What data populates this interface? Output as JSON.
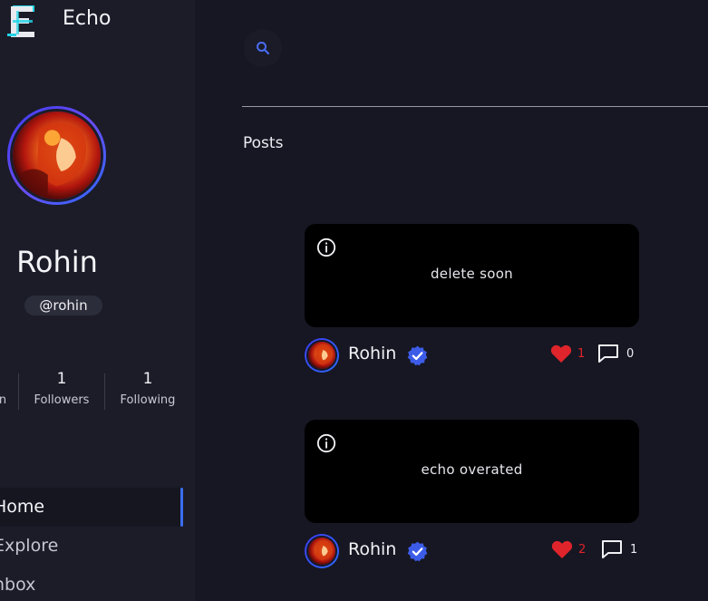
{
  "app": {
    "title": "Echo",
    "logo_letter": "E"
  },
  "profile": {
    "name": "Rohin",
    "handle": "@rohin",
    "stats": [
      {
        "value": "",
        "label": "n"
      },
      {
        "value": "1",
        "label": "Followers"
      },
      {
        "value": "1",
        "label": "Following"
      }
    ]
  },
  "nav": {
    "items": [
      {
        "label": "Home",
        "active": true
      },
      {
        "label": "Explore",
        "active": false
      },
      {
        "label": "nbox",
        "active": false
      }
    ]
  },
  "main": {
    "section_title": "Posts",
    "posts": [
      {
        "text": "delete soon",
        "author": "Rohin",
        "likes": "1",
        "comments": "0"
      },
      {
        "text": "echo overated",
        "author": "Rohin",
        "likes": "2",
        "comments": "1"
      }
    ]
  },
  "colors": {
    "accent": "#3a6df0",
    "like": "#e0242b",
    "background": "#161722",
    "sidebar": "#1b1c28"
  },
  "icons": [
    "echo-logo-icon",
    "search-icon",
    "info-icon",
    "verified-badge-icon",
    "heart-icon",
    "comment-icon"
  ]
}
